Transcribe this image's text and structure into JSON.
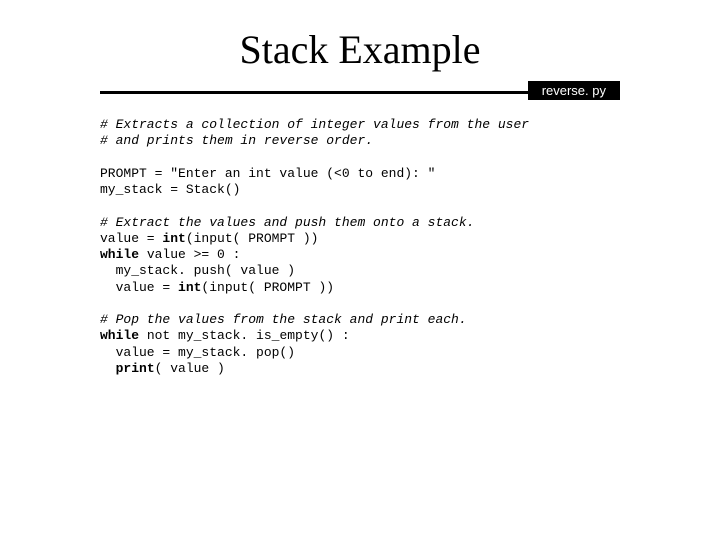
{
  "title": "Stack Example",
  "filename": "reverse. py",
  "code": {
    "c1": "# Extracts a collection of integer values from the user",
    "c2": "# and prints them in reverse order.",
    "l1": "PROMPT = \"Enter an int value (<0 to end): \"",
    "l2": "my_stack = Stack()",
    "c3": "# Extract the values and push them onto a stack.",
    "l3a": "value = ",
    "l3b": "int",
    "l3c": "(input( PROMPT ))",
    "l4a": "while",
    "l4b": " value >= 0 :",
    "l5": "  my_stack. push( value )",
    "l6a": "  value = ",
    "l6b": "int",
    "l6c": "(input( PROMPT ))",
    "c4": "# Pop the values from the stack and print each.",
    "l7a": "while",
    "l7b": " not my_stack. is_empty() :",
    "l8": "  value = my_stack. pop()",
    "l9a": "  ",
    "l9b": "print",
    "l9c": "( value )"
  }
}
